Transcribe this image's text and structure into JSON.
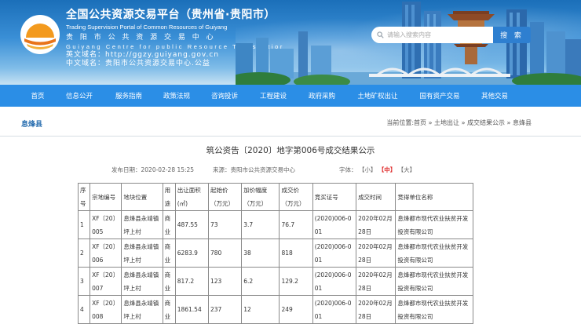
{
  "site": {
    "title_cn": "全国公共资源交易平台（贵州省·贵阳市）",
    "title_en": "Trading Supervision Portal of Common Resources of Guiyang",
    "center_cn": "贵 阳 市 公 共 资 源 交 易 中 心",
    "center_en": "Guiyang Centre for public Resource Transactior",
    "domain_en": "英文域名：http://ggzy.guiyang.gov.cn",
    "domain_cn": "中文域名：贵阳市公共资源交易中心.公益"
  },
  "search": {
    "placeholder": "请输入搜索内容",
    "button_label": "搜 索"
  },
  "nav": [
    "首页",
    "信息公开",
    "服务指南",
    "政策法规",
    "咨询投诉",
    "工程建设",
    "政府采购",
    "土地矿权出让",
    "国有资产交易",
    "其他交易"
  ],
  "breadcrumb": {
    "section": "息烽县",
    "trail": "当前位置:首页 » 土地出让 » 成交结果公示 » 息烽县"
  },
  "article": {
    "title": "筑公资告〔2020〕地字第006号成交结果公示",
    "date": "发布日期：2020-02-28 15:25",
    "source": "来源：贵阳市公共资源交易中心",
    "font_label": "字体：",
    "font_small": "【小】",
    "font_medium": "【中】",
    "font_large": "【大】"
  },
  "table": {
    "headers": [
      "序号",
      "宗地编号",
      "地块位置",
      "用途",
      "出让面积(㎡)",
      "起始价（万元）",
      "加价幅度（万元）",
      "成交价（万元）",
      "竞买证号",
      "成交时间",
      "竞得单位名称"
    ],
    "rows": [
      [
        "1",
        "XF〔20〕005",
        "息烽县永靖镇坪上村",
        "商业",
        "487.55",
        "73",
        "3.7",
        "76.7",
        "(2020)006-001",
        "2020年02月28日",
        "息烽都市现代农业扶贫开发投资有限公司"
      ],
      [
        "2",
        "XF〔20〕006",
        "息烽县永靖镇坪上村",
        "商业",
        "6283.9",
        "780",
        "38",
        "818",
        "(2020)006-001",
        "2020年02月28日",
        "息烽都市现代农业扶贫开发投资有限公司"
      ],
      [
        "3",
        "XF〔20〕007",
        "息烽县永靖镇坪上村",
        "商业",
        "817.2",
        "123",
        "6.2",
        "129.2",
        "(2020)006-001",
        "2020年02月28日",
        "息烽都市现代农业扶贫开发投资有限公司"
      ],
      [
        "4",
        "XF〔20〕008",
        "息烽县永靖镇坪上村",
        "商业",
        "1861.54",
        "237",
        "12",
        "249",
        "(2020)006-001",
        "2020年02月28日",
        "息烽都市现代农业扶贫开发投资有限公司"
      ]
    ]
  }
}
